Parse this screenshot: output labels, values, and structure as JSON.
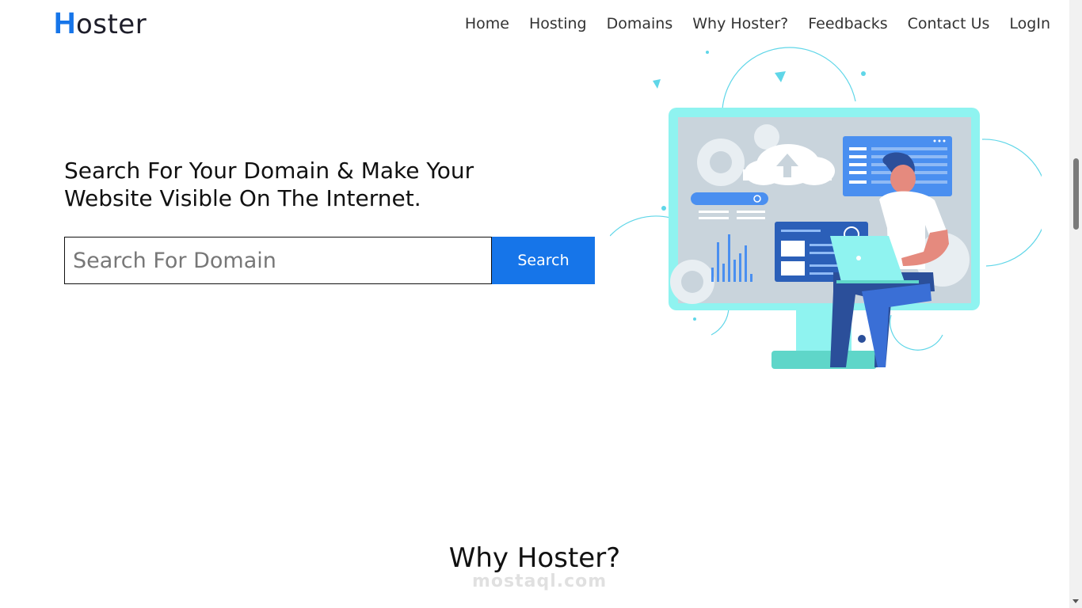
{
  "navbar": {
    "brand_first": "H",
    "brand_rest": "oster",
    "links": [
      "Home",
      "Hosting",
      "Domains",
      "Why Hoster?",
      "Feedbacks",
      "Contact Us",
      "LogIn"
    ]
  },
  "hero": {
    "title": "Search For Your Domain & Make Your Website Visible On The Internet.",
    "search_placeholder": "Search For Domain",
    "search_value": "",
    "search_button": "Search"
  },
  "why_section": {
    "title": "Why Hoster?"
  },
  "watermark": "mostaql.com",
  "colors": {
    "accent": "#1675e9",
    "monitor": "#8ff3f0",
    "screen": "#c9d4dc"
  },
  "icons": [
    "search-icon",
    "cloud-upload-icon",
    "gear-icon",
    "bar-chart-icon",
    "laptop-icon"
  ]
}
